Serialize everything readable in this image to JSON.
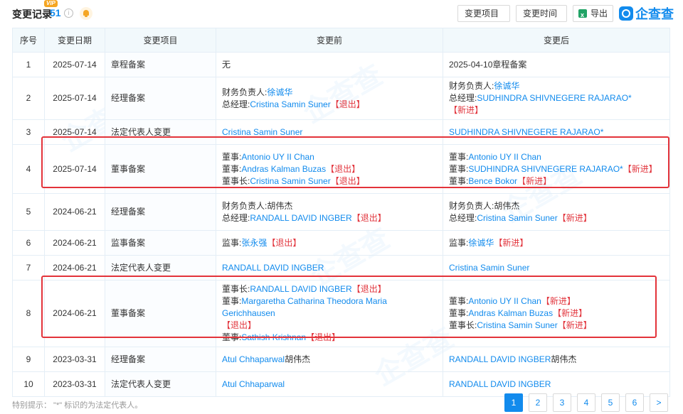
{
  "header": {
    "title": "变更记录",
    "count": "51",
    "vip": "VIP",
    "info": "i",
    "filter_item": "变更项目",
    "filter_time": "变更时间",
    "export": "导出",
    "logo": "企查查"
  },
  "table": {
    "columns": [
      "序号",
      "变更日期",
      "变更项目",
      "变更前",
      "变更后"
    ],
    "rows": [
      {
        "no": "1",
        "date": "2025-07-14",
        "item": "章程备案",
        "before": [
          [
            {
              "t": "无"
            }
          ]
        ],
        "after": [
          [
            {
              "t": "2025-04-10章程备案"
            }
          ]
        ]
      },
      {
        "no": "2",
        "date": "2025-07-14",
        "item": "经理备案",
        "before": [
          [
            {
              "t": "财务负责人:"
            },
            {
              "t": "徐诚华",
              "c": "lnk"
            }
          ],
          [
            {
              "t": "总经理:"
            },
            {
              "t": "Cristina Samin Suner",
              "c": "lnk"
            },
            {
              "t": "【退出】",
              "c": "out"
            }
          ]
        ],
        "after": [
          [
            {
              "t": "财务负责人:"
            },
            {
              "t": "徐诚华",
              "c": "lnk"
            }
          ],
          [
            {
              "t": "总经理:"
            },
            {
              "t": "SUDHINDRA SHIVNEGERE RAJARAO*",
              "c": "lnk"
            },
            {
              "t": "【新进】",
              "c": "in"
            }
          ]
        ]
      },
      {
        "no": "3",
        "date": "2025-07-14",
        "item": "法定代表人变更",
        "before": [
          [
            {
              "t": "Cristina Samin Suner",
              "c": "lnk"
            }
          ]
        ],
        "after": [
          [
            {
              "t": "SUDHINDRA SHIVNEGERE RAJARAO*",
              "c": "lnk"
            }
          ]
        ]
      },
      {
        "no": "4",
        "date": "2025-07-14",
        "item": "董事备案",
        "before": [
          [
            {
              "t": "董事:"
            },
            {
              "t": "Antonio UY II Chan",
              "c": "lnk"
            }
          ],
          [
            {
              "t": "董事:"
            },
            {
              "t": "Andras Kalman Buzas",
              "c": "lnk"
            },
            {
              "t": "【退出】",
              "c": "out"
            }
          ],
          [
            {
              "t": "董事长:"
            },
            {
              "t": "Cristina Samin Suner",
              "c": "lnk"
            },
            {
              "t": "【退出】",
              "c": "out"
            }
          ]
        ],
        "after": [
          [
            {
              "t": "董事:"
            },
            {
              "t": "Antonio UY II Chan",
              "c": "lnk"
            }
          ],
          [
            {
              "t": "董事:"
            },
            {
              "t": "SUDHINDRA SHIVNEGERE RAJARAO*",
              "c": "lnk"
            },
            {
              "t": "【新进】",
              "c": "in"
            }
          ],
          [
            {
              "t": "董事:"
            },
            {
              "t": "Bence Bokor",
              "c": "lnk"
            },
            {
              "t": "【新进】",
              "c": "in"
            }
          ]
        ]
      },
      {
        "no": "5",
        "date": "2024-06-21",
        "item": "经理备案",
        "before": [
          [
            {
              "t": "财务负责人:胡伟杰"
            }
          ],
          [
            {
              "t": "总经理:"
            },
            {
              "t": "RANDALL DAVID INGBER",
              "c": "lnk"
            },
            {
              "t": "【退出】",
              "c": "out"
            }
          ]
        ],
        "after": [
          [
            {
              "t": "财务负责人:胡伟杰"
            }
          ],
          [
            {
              "t": "总经理:"
            },
            {
              "t": "Cristina Samin Suner",
              "c": "lnk"
            },
            {
              "t": "【新进】",
              "c": "in"
            }
          ]
        ]
      },
      {
        "no": "6",
        "date": "2024-06-21",
        "item": "监事备案",
        "before": [
          [
            {
              "t": "监事:"
            },
            {
              "t": "张永强",
              "c": "lnk"
            },
            {
              "t": "【退出】",
              "c": "out"
            }
          ]
        ],
        "after": [
          [
            {
              "t": "监事:"
            },
            {
              "t": "徐诚华",
              "c": "lnk"
            },
            {
              "t": "【新进】",
              "c": "in"
            }
          ]
        ]
      },
      {
        "no": "7",
        "date": "2024-06-21",
        "item": "法定代表人变更",
        "before": [
          [
            {
              "t": "RANDALL DAVID INGBER",
              "c": "lnk"
            }
          ]
        ],
        "after": [
          [
            {
              "t": "Cristina Samin Suner",
              "c": "lnk"
            }
          ]
        ]
      },
      {
        "no": "8",
        "date": "2024-06-21",
        "item": "董事备案",
        "before": [
          [
            {
              "t": "董事长:"
            },
            {
              "t": "RANDALL DAVID INGBER",
              "c": "lnk"
            },
            {
              "t": "【退出】",
              "c": "out"
            }
          ],
          [
            {
              "t": "董事:"
            },
            {
              "t": "Margaretha Catharina Theodora Maria Gerichhausen",
              "c": "lnk"
            }
          ],
          [
            {
              "t": "【退出】",
              "c": "out"
            }
          ],
          [
            {
              "t": "董事:"
            },
            {
              "t": "Sathish Krishnan",
              "c": "lnk"
            },
            {
              "t": "【退出】",
              "c": "out"
            }
          ]
        ],
        "after": [
          [
            {
              "t": "董事:"
            },
            {
              "t": "Antonio UY II Chan",
              "c": "lnk"
            },
            {
              "t": "【新进】",
              "c": "in"
            }
          ],
          [
            {
              "t": "董事:"
            },
            {
              "t": "Andras Kalman Buzas",
              "c": "lnk"
            },
            {
              "t": "【新进】",
              "c": "in"
            }
          ],
          [
            {
              "t": "董事长:"
            },
            {
              "t": "Cristina Samin Suner",
              "c": "lnk"
            },
            {
              "t": "【新进】",
              "c": "in"
            }
          ]
        ]
      },
      {
        "no": "9",
        "date": "2023-03-31",
        "item": "经理备案",
        "before": [
          [
            {
              "t": "Atul Chhaparwal",
              "c": "lnk"
            },
            {
              "t": "胡伟杰"
            }
          ]
        ],
        "after": [
          [
            {
              "t": "RANDALL DAVID INGBER",
              "c": "lnk"
            },
            {
              "t": "胡伟杰"
            }
          ]
        ]
      },
      {
        "no": "10",
        "date": "2023-03-31",
        "item": "法定代表人变更",
        "before": [
          [
            {
              "t": "Atul Chhaparwal",
              "c": "lnk"
            }
          ]
        ],
        "after": [
          [
            {
              "t": "RANDALL DAVID INGBER",
              "c": "lnk"
            }
          ]
        ]
      }
    ]
  },
  "footer": {
    "hint": "特别提示：  \"*\" 标识的为法定代表人。",
    "pages": [
      "1",
      "2",
      "3",
      "4",
      "5",
      "6",
      ">"
    ],
    "active_page": "1"
  },
  "colors": {
    "accent": "#128bed",
    "warn": "#e2363e",
    "highlight": "#e3333a"
  }
}
